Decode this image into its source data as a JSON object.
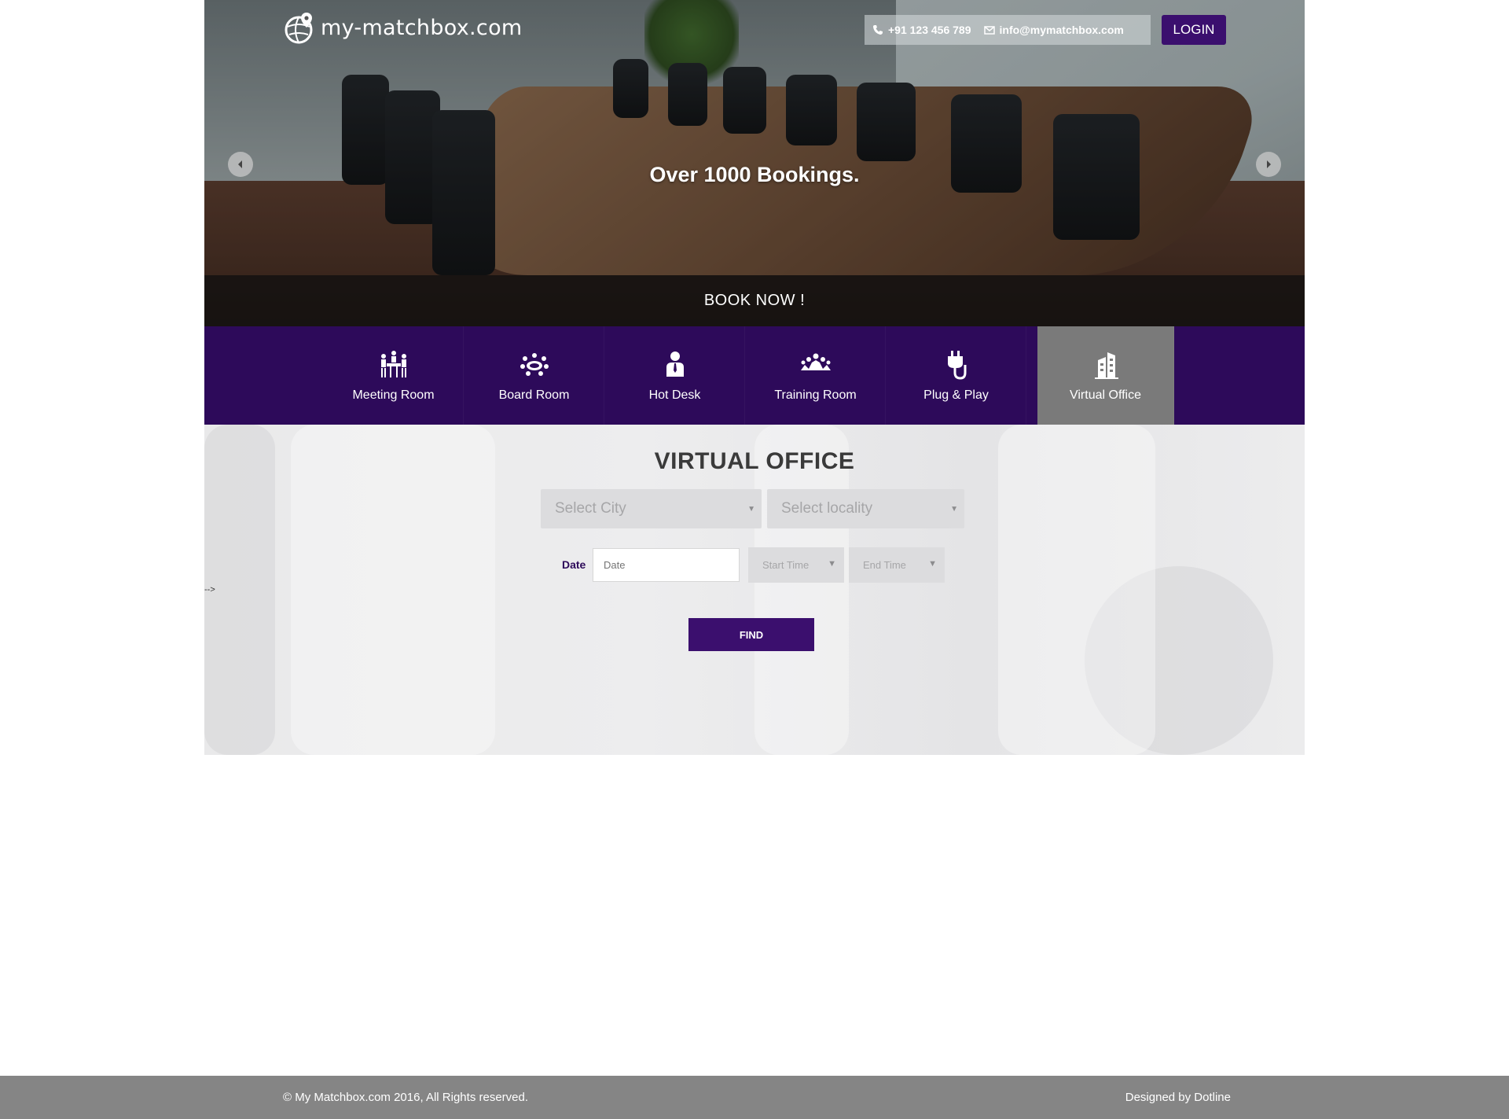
{
  "header": {
    "logo_text": "my-matchbox.com",
    "phone": "+91 123 456 789",
    "email": "info@mymatchbox.com",
    "login_label": "LOGIN"
  },
  "hero": {
    "headline": "Over 1000 Bookings.",
    "book_now_label": "BOOK NOW !"
  },
  "categories": [
    {
      "label": "Meeting Room",
      "icon": "meeting-room-icon"
    },
    {
      "label": "Board Room",
      "icon": "board-room-icon"
    },
    {
      "label": "Hot Desk",
      "icon": "hot-desk-icon"
    },
    {
      "label": "Training Room",
      "icon": "training-room-icon"
    },
    {
      "label": "Plug & Play",
      "icon": "plug-icon"
    },
    {
      "label": "Virtual Office",
      "icon": "building-icon",
      "active": true
    }
  ],
  "search": {
    "title": "VIRTUAL OFFICE",
    "city_placeholder": "Select City",
    "locality_placeholder": "Select locality",
    "date_label": "Date",
    "date_placeholder": "Date",
    "start_time": "Start Time",
    "end_time": "End Time",
    "find_label": "FIND"
  },
  "stray_text": "-->",
  "footer": {
    "copyright": "© My Matchbox.com 2016, All Rights reserved.",
    "designed_by": "Designed by Dotline"
  },
  "colors": {
    "brand_purple": "#3b0f6e",
    "nav_purple": "#2d0a5a",
    "active_tab": "#7a7a7a",
    "footer_gray": "#858585"
  }
}
